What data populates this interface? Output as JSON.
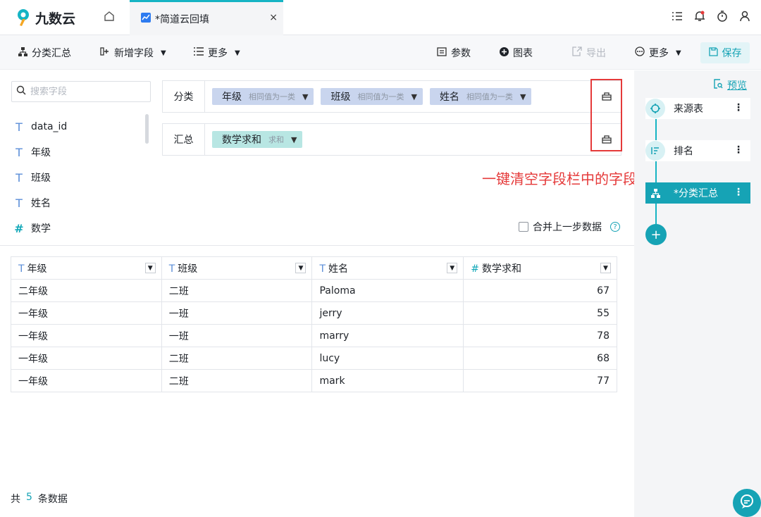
{
  "app": {
    "logo_text": "九数云",
    "tab_title": "*简道云回填",
    "tab_close": "×"
  },
  "toolbar": {
    "group_summary": "分类汇总",
    "add_field": "新增字段",
    "more_left": "更多",
    "params": "参数",
    "chart": "图表",
    "export": "导出",
    "more_right": "更多",
    "save": "保存"
  },
  "search": {
    "placeholder": "搜索字段"
  },
  "fields": [
    {
      "type": "T",
      "name": "data_id"
    },
    {
      "type": "T",
      "name": "年级"
    },
    {
      "type": "T",
      "name": "班级"
    },
    {
      "type": "T",
      "name": "姓名"
    },
    {
      "type": "#",
      "name": "数学"
    }
  ],
  "config": {
    "group_label": "分类",
    "group_chips": [
      {
        "name": "年级",
        "sub": "相同值为一类"
      },
      {
        "name": "班级",
        "sub": "相同值为一类"
      },
      {
        "name": "姓名",
        "sub": "相同值为一类"
      }
    ],
    "summary_label": "汇总",
    "summary_chips": [
      {
        "name": "数学求和",
        "sub": "求和"
      }
    ]
  },
  "annotation": "一键清空字段栏中的字段",
  "merge_label": "合并上一步数据",
  "table": {
    "columns": [
      {
        "type": "T",
        "name": "年级"
      },
      {
        "type": "T",
        "name": "班级"
      },
      {
        "type": "T",
        "name": "姓名"
      },
      {
        "type": "#",
        "name": "数学求和"
      }
    ],
    "rows": [
      [
        "二年级",
        "二班",
        "Paloma",
        "67"
      ],
      [
        "一年级",
        "一班",
        "jerry",
        "55"
      ],
      [
        "一年级",
        "一班",
        "marry",
        "78"
      ],
      [
        "一年级",
        "二班",
        "lucy",
        "68"
      ],
      [
        "一年级",
        "二班",
        "mark",
        "77"
      ]
    ]
  },
  "total": {
    "prefix": "共",
    "count": "5",
    "suffix": "条数据"
  },
  "flow": {
    "preview": "预览",
    "nodes": [
      {
        "label": "来源表"
      },
      {
        "label": "排名"
      },
      {
        "label": "*分类汇总"
      }
    ],
    "add": "+"
  },
  "colors": {
    "accent": "#16a3b5",
    "annotation": "#e53a3a",
    "dim_chip": "#c9d5ee",
    "measure_chip": "#b8e6e3"
  }
}
